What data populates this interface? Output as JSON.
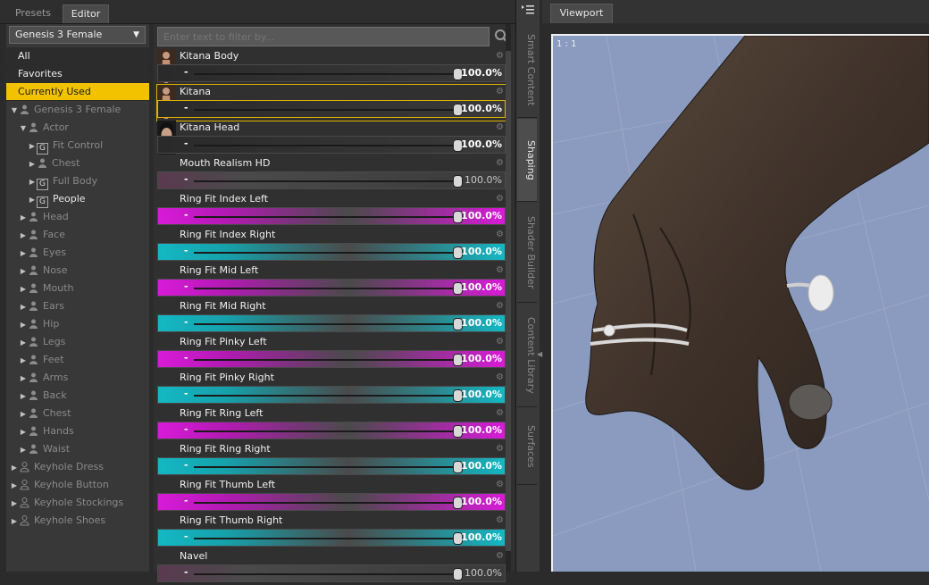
{
  "tabs": {
    "presets": "Presets",
    "editor": "Editor"
  },
  "figure_selector": {
    "value": "Genesis 3 Female",
    "arrow": "▼"
  },
  "categories": {
    "all": "All",
    "favorites": "Favorites",
    "current": "Currently Used"
  },
  "tree": [
    {
      "label": "Genesis 3 Female",
      "tri": "▼",
      "icon": "person"
    },
    {
      "label": "Actor",
      "tri": "▼",
      "icon": "person"
    },
    {
      "label": "Fit Control",
      "tri": "▶",
      "icon": "G"
    },
    {
      "label": "Chest",
      "tri": "▶",
      "icon": "person"
    },
    {
      "label": "Full Body",
      "tri": "▶",
      "icon": "G"
    },
    {
      "label": "People",
      "tri": "▶",
      "icon": "G"
    },
    {
      "label": "Head",
      "tri": "▶",
      "icon": "person"
    },
    {
      "label": "Face",
      "tri": "▶",
      "icon": "person"
    },
    {
      "label": "Eyes",
      "tri": "▶",
      "icon": "person"
    },
    {
      "label": "Nose",
      "tri": "▶",
      "icon": "person"
    },
    {
      "label": "Mouth",
      "tri": "▶",
      "icon": "person"
    },
    {
      "label": "Ears",
      "tri": "▶",
      "icon": "person"
    },
    {
      "label": "Hip",
      "tri": "▶",
      "icon": "person"
    },
    {
      "label": "Legs",
      "tri": "▶",
      "icon": "person"
    },
    {
      "label": "Feet",
      "tri": "▶",
      "icon": "person"
    },
    {
      "label": "Arms",
      "tri": "▶",
      "icon": "person"
    },
    {
      "label": "Back",
      "tri": "▶",
      "icon": "person"
    },
    {
      "label": "Chest",
      "tri": "▶",
      "icon": "person"
    },
    {
      "label": "Hands",
      "tri": "▶",
      "icon": "person"
    },
    {
      "label": "Waist",
      "tri": "▶",
      "icon": "person"
    },
    {
      "label": "Keyhole Dress",
      "tri": "▶",
      "icon": "outfit"
    },
    {
      "label": "Keyhole Button",
      "tri": "▶",
      "icon": "outfit"
    },
    {
      "label": "Keyhole Stockings",
      "tri": "▶",
      "icon": "outfit"
    },
    {
      "label": "Keyhole Shoes",
      "tri": "▶",
      "icon": "outfit"
    }
  ],
  "filter": {
    "placeholder": "Enter text to filter by..."
  },
  "properties": [
    {
      "label": "Kitana Body",
      "value": "100.0%",
      "style": "dark",
      "thumb": "body",
      "level": 1.0
    },
    {
      "label": "Kitana",
      "value": "100.0%",
      "style": "dark",
      "thumb": "body",
      "level": 1.0,
      "selected": true
    },
    {
      "label": "Kitana Head",
      "value": "100.0%",
      "style": "dark",
      "thumb": "head",
      "level": 1.0
    },
    {
      "label": "Mouth Realism HD",
      "value": "100.0%",
      "style": "muted",
      "thumb": "none",
      "level": 1.0
    },
    {
      "label": "Ring Fit Index Left",
      "value": "100.0%",
      "style": "magenta",
      "thumb": "none",
      "level": 1.0
    },
    {
      "label": "Ring Fit Index Right",
      "value": "100.0%",
      "style": "cyan",
      "thumb": "none",
      "level": 1.0
    },
    {
      "label": "Ring Fit Mid Left",
      "value": "100.0%",
      "style": "magenta",
      "thumb": "none",
      "level": 1.0
    },
    {
      "label": "Ring Fit Mid Right",
      "value": "100.0%",
      "style": "cyan",
      "thumb": "none",
      "level": 1.0
    },
    {
      "label": "Ring Fit Pinky Left",
      "value": "100.0%",
      "style": "magenta",
      "thumb": "none",
      "level": 1.0
    },
    {
      "label": "Ring Fit Pinky Right",
      "value": "100.0%",
      "style": "cyan",
      "thumb": "none",
      "level": 1.0
    },
    {
      "label": "Ring Fit Ring Left",
      "value": "100.0%",
      "style": "magenta",
      "thumb": "none",
      "level": 1.0
    },
    {
      "label": "Ring Fit Ring Right",
      "value": "100.0%",
      "style": "cyan",
      "thumb": "none",
      "level": 1.0
    },
    {
      "label": "Ring Fit Thumb Left",
      "value": "100.0%",
      "style": "magenta",
      "thumb": "none",
      "level": 1.0
    },
    {
      "label": "Ring Fit Thumb Right",
      "value": "100.0%",
      "style": "cyan",
      "thumb": "none",
      "level": 1.0
    },
    {
      "label": "Navel",
      "value": "100.0%",
      "style": "muted",
      "thumb": "none",
      "level": 1.0
    }
  ],
  "vertical_tabs": {
    "smart": "Smart Content",
    "shaping": "Shaping",
    "shader": "Shader Builder",
    "content": "Content Library",
    "surfaces": "Surfaces"
  },
  "viewport": {
    "tab": "Viewport",
    "zoom": "1 : 1"
  },
  "colors": {
    "accent": "#f2c200",
    "magenta": "#d81ad8",
    "cyan": "#13b8c4",
    "viewport_bg": "#8a9bbf"
  }
}
